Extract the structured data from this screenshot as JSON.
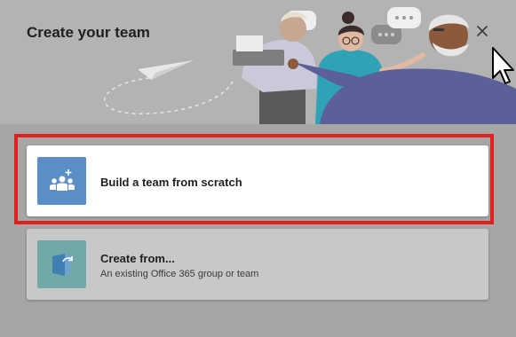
{
  "dialog": {
    "title": "Create your team",
    "close_icon": "close-icon"
  },
  "options": {
    "scratch": {
      "title": "Build a team from scratch",
      "icon": "team-add-icon"
    },
    "from": {
      "title": "Create from...",
      "subtitle": "An existing Office 365 group or team",
      "icon": "copy-from-icon"
    }
  },
  "colors": {
    "highlight": "#e0201f",
    "scratch_tile": "#5b8ec5",
    "from_tile": "#73a8a8"
  }
}
